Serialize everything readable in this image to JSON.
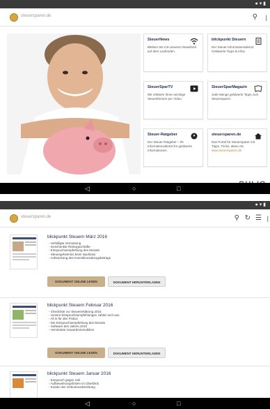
{
  "screen1": {
    "brand": "steuersparen.de",
    "tiles": [
      {
        "title": "SteuerNews",
        "desc": "Bleiben Sie mit unserem Newsfeed auf dem Laufenden.",
        "link": "",
        "icon": "wifi-icon"
      },
      {
        "title": "blickpunkt Steuern",
        "desc": "Der Steuer-Informationsdienst: Geldwerte Tipps & Infos.",
        "link": "",
        "icon": "document-icon"
      },
      {
        "title": "SteuerSparTV",
        "desc": "Wir erklären Ihnen wichtige Steuerthemen per Video.",
        "link": "",
        "icon": "play-icon"
      },
      {
        "title": "SteuerSparMagazin",
        "desc": "Jede Menge geldwerte Tipps zum Steuersparen.",
        "link": "",
        "icon": "magazine-icon"
      },
      {
        "title": "Steuer-Ratgeber",
        "desc": "Der Steuer-Ratgeber – Ihr Informationsdienst für geldwerte Informationen.",
        "link": "",
        "icon": "compass-icon"
      },
      {
        "title": "steuersparen.de",
        "desc": "Das Portal für Steuersparer mit Tipps, Tricks, Ideen etc.",
        "link": "www.steuersparen.de",
        "icon": "home-icon"
      }
    ],
    "publisher_logo": "BUŁIO",
    "nav": {
      "back": "◁",
      "home": "○",
      "recents": "□"
    }
  },
  "screen2": {
    "brand": "steuersparen.de",
    "read_label": "DOKUMENT ONLINE LESEN",
    "download_label": "DOKUMENT HERUNTERLADEN",
    "issues": [
      {
        "title": "blickpunkt Steuern März 2016",
        "bullets": [
          "- Verbilligte Vermietung",
          "- Geschenkte Risikogeschäfte",
          "- Einspruchsempfehlung des Monats",
          "- Steuergeheimnis beim Nachlass",
          "- Aufstockung des Investitionsabzugsbetrags"
        ]
      },
      {
        "title": "blickpunkt Steuern Februar 2016",
        "bullets": [
          "- Checkliste zur Steuererklärung 2015",
          "- Unsere Einspruchsempfehlungen zahlen sich aus",
          "- All in für den Fiskus",
          "- Die Einspruchsempfehlung des Monats",
          "- Software des Jahres 2015",
          "- Vermietete Gewerbeimmobilien"
        ]
      },
      {
        "title": "blickpunkt Steuern Januar 2016",
        "bullets": [
          "- Einspruch gegen Soli",
          "- Aufbewahrungsfristen im Überblick",
          "- Kosten der Geburtsvorbereitung"
        ]
      }
    ],
    "nav": {
      "back": "◁",
      "home": "○",
      "recents": "□"
    }
  }
}
